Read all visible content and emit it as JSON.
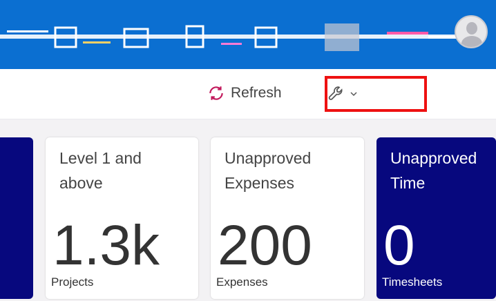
{
  "toolbar": {
    "refresh_label": "Refresh"
  },
  "tiles": [
    {
      "title": "",
      "value": "",
      "unit": ""
    },
    {
      "title_line1": "Level 1 and",
      "title_line2": "above",
      "value": "1.3k",
      "unit": "Projects"
    },
    {
      "title_line1": "Unapproved",
      "title_line2": "Expenses",
      "value": "200",
      "unit": "Expenses"
    },
    {
      "title_line1": "Unapproved",
      "title_line2": "Time",
      "value": "0",
      "unit": "Timesheets"
    }
  ],
  "colors": {
    "topbar": "#0b6fd1",
    "tile_dark": "#07087e",
    "highlight": "#ee1111",
    "refresh_icon": "#c2185b"
  },
  "icons": {
    "refresh": "refresh-icon",
    "tools": "wrench-icon",
    "dropdown": "chevron-down-icon",
    "avatar": "user-avatar-icon"
  }
}
